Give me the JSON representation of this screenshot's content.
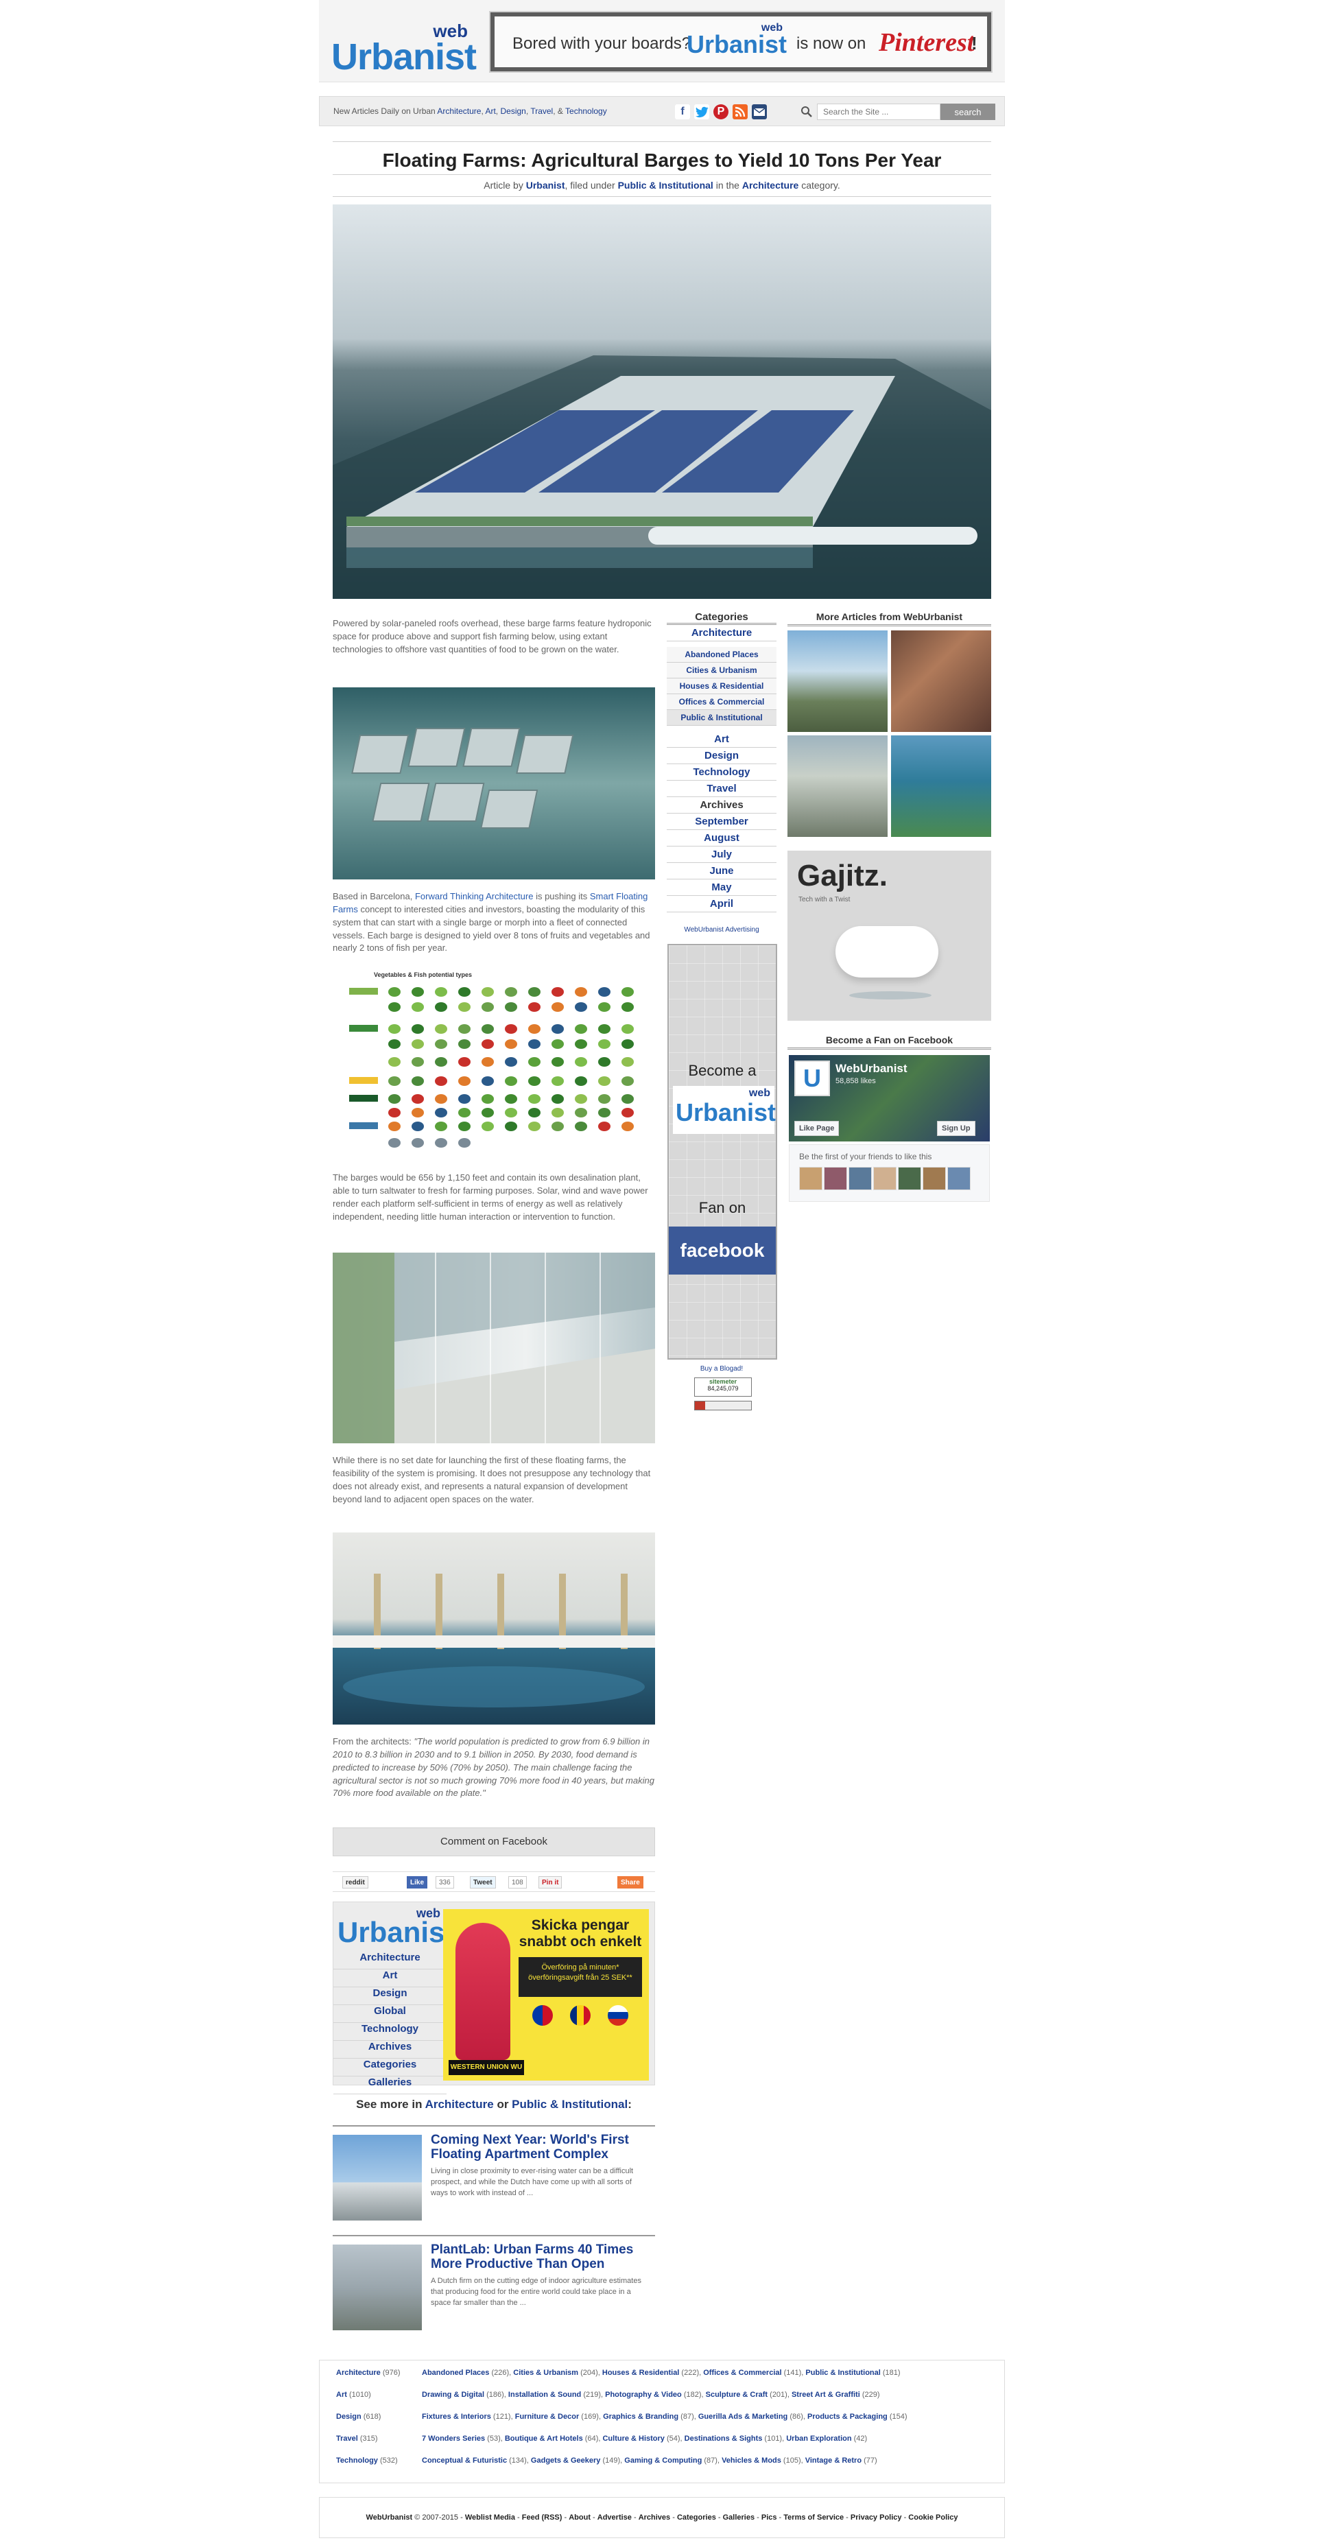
{
  "header": {
    "logo_web": "web",
    "logo_urbanist": "Urbanist",
    "banner_text_1": "Bored with your boards?",
    "banner_logo_web": "web",
    "banner_logo_urbanist": "Urbanist",
    "banner_text_2": "is now on",
    "banner_pinterest": "Pinterest",
    "banner_excl": "!"
  },
  "navbar": {
    "tagline_prefix": "New Articles Daily on Urban",
    "links": [
      "Architecture",
      "Art",
      "Design",
      "Travel",
      "Technology"
    ],
    "sep1": ",",
    "sep2": ",",
    "sep3": ",",
    "sep4": ", &",
    "social": [
      "facebook-icon",
      "twitter-icon",
      "pinterest-icon",
      "rss-icon",
      "email-icon"
    ],
    "social_colors": [
      "#3b5998",
      "#1da1f2",
      "#cb2027",
      "#f26522",
      "#2b4a7a"
    ],
    "search_placeholder": "Search the Site ...",
    "search_button": "search"
  },
  "article": {
    "title": "Floating Farms: Agricultural Barges to Yield 10 Tons Per Year",
    "byline_1": "Article by",
    "author": "Urbanist",
    "byline_2": ", filed under",
    "filed": "Public & Institutional",
    "byline_3": "in the",
    "category": "Architecture",
    "byline_4": "category.",
    "p1": "Powered by solar-paneled roofs overhead, these barge farms feature hydroponic space for produce above and support fish farming below, using extant technologies to offshore vast quantities of food to be grown on the water.",
    "p2_a": "Based in Barcelona,",
    "p2_link1": "Forward Thinking Architecture",
    "p2_b": "is pushing its",
    "p2_link2": "Smart Floating Farms",
    "p2_c": "concept to interested cities and investors, boasting the modularity of this system that can start with a single barge or morph into a fleet of connected vessels. Each barge is designed to yield over 8 tons of fruits and vegetables and nearly 2 tons of fish per year.",
    "chart_caption": "Vegetables & Fish potential types",
    "p3": "The barges would be 656 by 1,150 feet and contain its own desalination plant, able to turn saltwater to fresh for farming purposes. Solar, wind and wave power render each platform self-sufficient in terms of energy as well as relatively independent, needing little human interaction or intervention to function.",
    "p4": "While there is no set date for launching the first of these floating farms, the feasibility of the system is promising. It does not presuppose any technology that does not already exist, and represents a natural expansion of development beyond land to adjacent open spaces on the water.",
    "p5_a": "From the architects:",
    "p5_quote": "\"The world population is predicted to grow from 6.9 billion in 2010 to 8.3 billion in 2030 and to 9.1 billion in 2050. By 2030, food demand is predicted to increase by 50% (70% by 2050). The main challenge facing the agricultural sector is not so much growing 70% more food in 40 years, but making 70% more food available on the plate.\"",
    "comment_button": "Comment on Facebook"
  },
  "share": {
    "reddit": "reddit",
    "like": "Like",
    "like_count": "336",
    "tweet": "Tweet",
    "tweet_count": "108",
    "pinit": "Pin it",
    "share": "Share"
  },
  "categories": {
    "heading": "Categories",
    "architecture": "Architecture",
    "sub": [
      "Abandoned Places",
      "Cities & Urbanism",
      "Houses & Residential",
      "Offices & Commercial",
      "Public & Institutional"
    ],
    "main": [
      "Art",
      "Design",
      "Technology",
      "Travel"
    ],
    "archives_heading": "Archives",
    "archives": [
      "September",
      "August",
      "July",
      "June",
      "May",
      "April"
    ],
    "ad_label": "WebUrbanist Advertising",
    "fan_become": "Become a",
    "fan_web": "web",
    "fan_urbanist": "Urbanist",
    "fan_on": "Fan on",
    "fan_facebook": "facebook",
    "buy_blogad": "Buy a Blogad!",
    "sitemeter": "sitemeter",
    "sitemeter_count": "84,245,079"
  },
  "sidebar": {
    "more_heading": "More Articles from WebUrbanist",
    "gajitz_logo": "Gajitz.",
    "gajitz_tag": "Tech with a Twist",
    "fan_heading": "Become a Fan on Facebook",
    "fb_name": "WebUrbanist",
    "fb_likes": "58,858 likes",
    "fb_like_btn": "Like Page",
    "fb_signup": "Sign Up",
    "fb_first": "Be the first of your friends to like this"
  },
  "lower_ad": {
    "logo_web": "web",
    "logo_urbanist": "Urbanist",
    "links": [
      "Architecture",
      "Art",
      "Design",
      "Global",
      "Technology",
      "Archives",
      "Categories",
      "Galleries"
    ],
    "wu_headline": "Skicka pengar snabbt och enkelt",
    "wu_line1": "Överföring på minuten*",
    "wu_line2": "överföringsavgift från 25 SEK**",
    "wu_brand": "WESTERN UNION WU"
  },
  "seemore": {
    "prefix": "See more in",
    "cat1": "Architecture",
    "or": "or",
    "cat2": "Public & Institutional",
    "suffix": ":"
  },
  "related": [
    {
      "title": "Coming Next Year: World's First Floating Apartment Complex",
      "desc": "Living in close proximity to ever-rising water can be a difficult prospect, and while the Dutch have come up with all sorts of ways to work with instead of ..."
    },
    {
      "title": "PlantLab: Urban Farms 40 Times More Productive Than Open",
      "desc": "A Dutch firm on the cutting edge of indoor agriculture estimates that producing food for the entire world could take place in a space far smaller than the ..."
    }
  ],
  "footer_index": [
    {
      "main": "Architecture",
      "count": "(976)",
      "items": [
        [
          "Abandoned Places",
          "(226)"
        ],
        [
          "Cities & Urbanism",
          "(204)"
        ],
        [
          "Houses & Residential",
          "(222)"
        ],
        [
          "Offices & Commercial",
          "(141)"
        ],
        [
          "Public & Institutional",
          "(181)"
        ]
      ]
    },
    {
      "main": "Art",
      "count": "(1010)",
      "items": [
        [
          "Drawing & Digital",
          "(186)"
        ],
        [
          "Installation & Sound",
          "(219)"
        ],
        [
          "Photography & Video",
          "(182)"
        ],
        [
          "Sculpture & Craft",
          "(201)"
        ],
        [
          "Street Art & Graffiti",
          "(229)"
        ]
      ]
    },
    {
      "main": "Design",
      "count": "(618)",
      "items": [
        [
          "Fixtures & Interiors",
          "(121)"
        ],
        [
          "Furniture & Decor",
          "(169)"
        ],
        [
          "Graphics & Branding",
          "(87)"
        ],
        [
          "Guerilla Ads & Marketing",
          "(86)"
        ],
        [
          "Products & Packaging",
          "(154)"
        ]
      ]
    },
    {
      "main": "Travel",
      "count": "(315)",
      "items": [
        [
          "7 Wonders Series",
          "(53)"
        ],
        [
          "Boutique & Art Hotels",
          "(64)"
        ],
        [
          "Culture & History",
          "(54)"
        ],
        [
          "Destinations & Sights",
          "(101)"
        ],
        [
          "Urban Exploration",
          "(42)"
        ]
      ]
    },
    {
      "main": "Technology",
      "count": "(532)",
      "items": [
        [
          "Conceptual & Futuristic",
          "(134)"
        ],
        [
          "Gadgets & Geekery",
          "(149)"
        ],
        [
          "Gaming & Computing",
          "(87)"
        ],
        [
          "Vehicles & Mods",
          "(105)"
        ],
        [
          "Vintage & Retro",
          "(77)"
        ]
      ]
    }
  ],
  "copyright": {
    "site": "WebUrbanist",
    "text": "© 2007-2015",
    "links": [
      "Weblist Media",
      "Feed (RSS)",
      "About",
      "Advertise",
      "Archives",
      "Categories",
      "Galleries",
      "Pics",
      "Terms of Service",
      "Privacy Policy",
      "Cookie Policy"
    ]
  }
}
